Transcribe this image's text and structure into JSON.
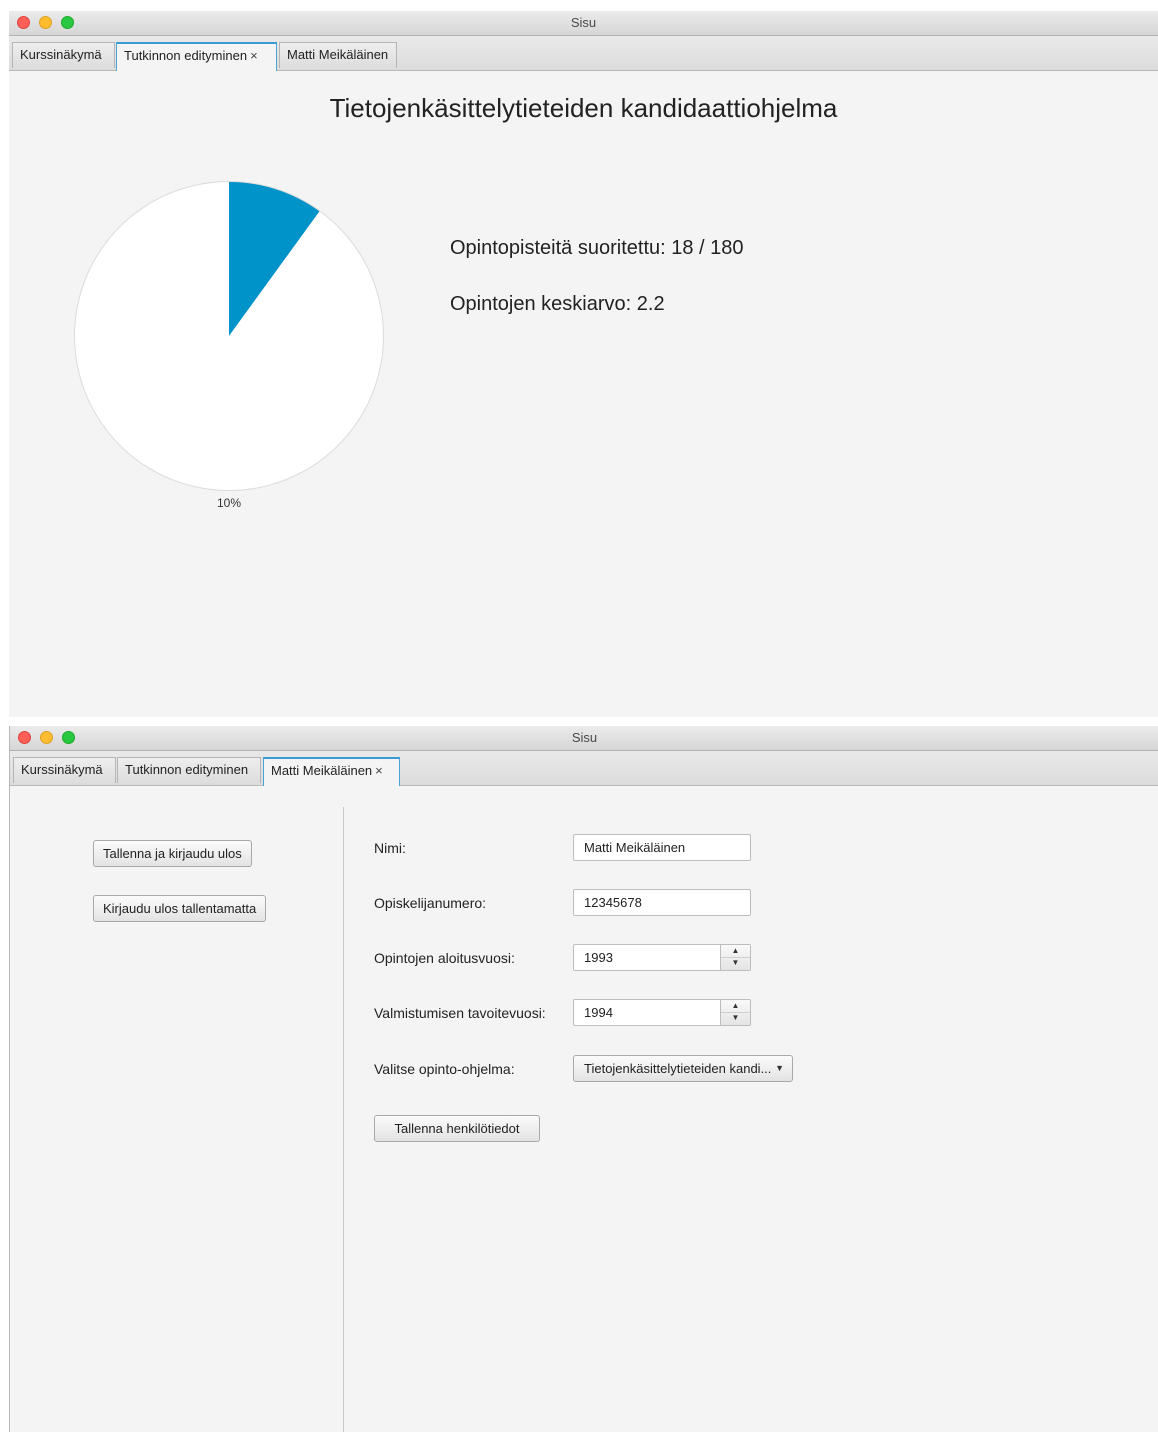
{
  "windows": [
    {
      "title": "Sisu",
      "tabs": [
        {
          "label": "Kurssinäkymä",
          "active": false
        },
        {
          "label": "Tutkinnon edityminen",
          "active": true,
          "close": "×"
        },
        {
          "label": "Matti Meikäläinen",
          "active": false
        }
      ],
      "degree_title": "Tietojenkäsittelytieteiden kandidaattiohjelma",
      "stats": {
        "credits": "Opintopisteitä suoritettu: 18 / 180",
        "average": "Opintojen keskiarvo: 2.2"
      }
    },
    {
      "title": "Sisu",
      "tabs": [
        {
          "label": "Kurssinäkymä",
          "active": false
        },
        {
          "label": "Tutkinnon edityminen",
          "active": false
        },
        {
          "label": "Matti Meikäläinen",
          "active": true,
          "close": "×"
        }
      ],
      "buttons": {
        "save_logout": "Tallenna ja kirjaudu ulos",
        "logout_nosave": "Kirjaudu ulos tallentamatta",
        "save_info": "Tallenna henkilötiedot"
      },
      "form": {
        "name_label": "Nimi:",
        "name_value": "Matti Meikäläinen",
        "student_no_label": "Opiskelijanumero:",
        "student_no_value": "12345678",
        "start_year_label": "Opintojen aloitusvuosi:",
        "start_year_value": "1993",
        "grad_year_label": "Valmistumisen tavoitevuosi:",
        "grad_year_value": "1994",
        "program_label": "Valitse opinto-ohjelma:",
        "program_value": "Tietojenkäsittelytieteiden kandi..."
      }
    }
  ],
  "chart_data": {
    "type": "pie",
    "slices": [
      {
        "label": "10%",
        "value": 10,
        "color": "#0093c9"
      },
      {
        "label": "",
        "value": 90,
        "color": "#ffffff"
      }
    ],
    "data_label": "10%"
  },
  "colors": {
    "accent": "#0093c9",
    "tab_active_border": "#3a9bd5"
  }
}
